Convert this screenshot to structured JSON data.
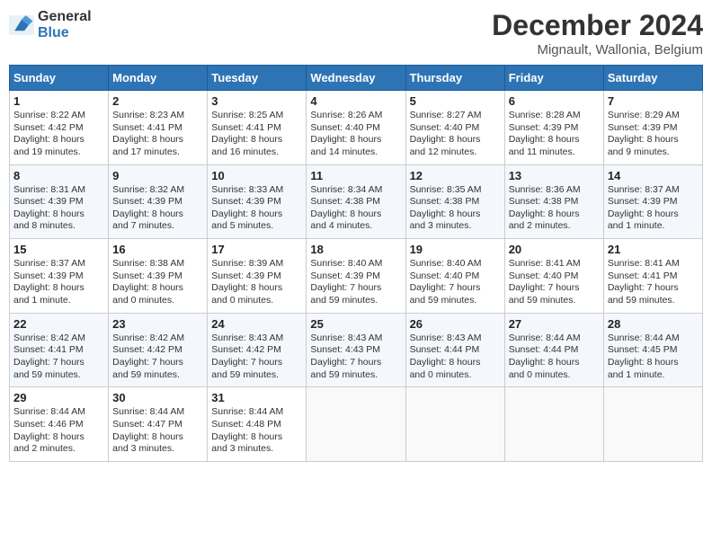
{
  "logo": {
    "general": "General",
    "blue": "Blue"
  },
  "title": "December 2024",
  "subtitle": "Mignault, Wallonia, Belgium",
  "days_header": [
    "Sunday",
    "Monday",
    "Tuesday",
    "Wednesday",
    "Thursday",
    "Friday",
    "Saturday"
  ],
  "weeks": [
    [
      {
        "day": "1",
        "lines": [
          "Sunrise: 8:22 AM",
          "Sunset: 4:42 PM",
          "Daylight: 8 hours",
          "and 19 minutes."
        ]
      },
      {
        "day": "2",
        "lines": [
          "Sunrise: 8:23 AM",
          "Sunset: 4:41 PM",
          "Daylight: 8 hours",
          "and 17 minutes."
        ]
      },
      {
        "day": "3",
        "lines": [
          "Sunrise: 8:25 AM",
          "Sunset: 4:41 PM",
          "Daylight: 8 hours",
          "and 16 minutes."
        ]
      },
      {
        "day": "4",
        "lines": [
          "Sunrise: 8:26 AM",
          "Sunset: 4:40 PM",
          "Daylight: 8 hours",
          "and 14 minutes."
        ]
      },
      {
        "day": "5",
        "lines": [
          "Sunrise: 8:27 AM",
          "Sunset: 4:40 PM",
          "Daylight: 8 hours",
          "and 12 minutes."
        ]
      },
      {
        "day": "6",
        "lines": [
          "Sunrise: 8:28 AM",
          "Sunset: 4:39 PM",
          "Daylight: 8 hours",
          "and 11 minutes."
        ]
      },
      {
        "day": "7",
        "lines": [
          "Sunrise: 8:29 AM",
          "Sunset: 4:39 PM",
          "Daylight: 8 hours",
          "and 9 minutes."
        ]
      }
    ],
    [
      {
        "day": "8",
        "lines": [
          "Sunrise: 8:31 AM",
          "Sunset: 4:39 PM",
          "Daylight: 8 hours",
          "and 8 minutes."
        ]
      },
      {
        "day": "9",
        "lines": [
          "Sunrise: 8:32 AM",
          "Sunset: 4:39 PM",
          "Daylight: 8 hours",
          "and 7 minutes."
        ]
      },
      {
        "day": "10",
        "lines": [
          "Sunrise: 8:33 AM",
          "Sunset: 4:39 PM",
          "Daylight: 8 hours",
          "and 5 minutes."
        ]
      },
      {
        "day": "11",
        "lines": [
          "Sunrise: 8:34 AM",
          "Sunset: 4:38 PM",
          "Daylight: 8 hours",
          "and 4 minutes."
        ]
      },
      {
        "day": "12",
        "lines": [
          "Sunrise: 8:35 AM",
          "Sunset: 4:38 PM",
          "Daylight: 8 hours",
          "and 3 minutes."
        ]
      },
      {
        "day": "13",
        "lines": [
          "Sunrise: 8:36 AM",
          "Sunset: 4:38 PM",
          "Daylight: 8 hours",
          "and 2 minutes."
        ]
      },
      {
        "day": "14",
        "lines": [
          "Sunrise: 8:37 AM",
          "Sunset: 4:39 PM",
          "Daylight: 8 hours",
          "and 1 minute."
        ]
      }
    ],
    [
      {
        "day": "15",
        "lines": [
          "Sunrise: 8:37 AM",
          "Sunset: 4:39 PM",
          "Daylight: 8 hours",
          "and 1 minute."
        ]
      },
      {
        "day": "16",
        "lines": [
          "Sunrise: 8:38 AM",
          "Sunset: 4:39 PM",
          "Daylight: 8 hours",
          "and 0 minutes."
        ]
      },
      {
        "day": "17",
        "lines": [
          "Sunrise: 8:39 AM",
          "Sunset: 4:39 PM",
          "Daylight: 8 hours",
          "and 0 minutes."
        ]
      },
      {
        "day": "18",
        "lines": [
          "Sunrise: 8:40 AM",
          "Sunset: 4:39 PM",
          "Daylight: 7 hours",
          "and 59 minutes."
        ]
      },
      {
        "day": "19",
        "lines": [
          "Sunrise: 8:40 AM",
          "Sunset: 4:40 PM",
          "Daylight: 7 hours",
          "and 59 minutes."
        ]
      },
      {
        "day": "20",
        "lines": [
          "Sunrise: 8:41 AM",
          "Sunset: 4:40 PM",
          "Daylight: 7 hours",
          "and 59 minutes."
        ]
      },
      {
        "day": "21",
        "lines": [
          "Sunrise: 8:41 AM",
          "Sunset: 4:41 PM",
          "Daylight: 7 hours",
          "and 59 minutes."
        ]
      }
    ],
    [
      {
        "day": "22",
        "lines": [
          "Sunrise: 8:42 AM",
          "Sunset: 4:41 PM",
          "Daylight: 7 hours",
          "and 59 minutes."
        ]
      },
      {
        "day": "23",
        "lines": [
          "Sunrise: 8:42 AM",
          "Sunset: 4:42 PM",
          "Daylight: 7 hours",
          "and 59 minutes."
        ]
      },
      {
        "day": "24",
        "lines": [
          "Sunrise: 8:43 AM",
          "Sunset: 4:42 PM",
          "Daylight: 7 hours",
          "and 59 minutes."
        ]
      },
      {
        "day": "25",
        "lines": [
          "Sunrise: 8:43 AM",
          "Sunset: 4:43 PM",
          "Daylight: 7 hours",
          "and 59 minutes."
        ]
      },
      {
        "day": "26",
        "lines": [
          "Sunrise: 8:43 AM",
          "Sunset: 4:44 PM",
          "Daylight: 8 hours",
          "and 0 minutes."
        ]
      },
      {
        "day": "27",
        "lines": [
          "Sunrise: 8:44 AM",
          "Sunset: 4:44 PM",
          "Daylight: 8 hours",
          "and 0 minutes."
        ]
      },
      {
        "day": "28",
        "lines": [
          "Sunrise: 8:44 AM",
          "Sunset: 4:45 PM",
          "Daylight: 8 hours",
          "and 1 minute."
        ]
      }
    ],
    [
      {
        "day": "29",
        "lines": [
          "Sunrise: 8:44 AM",
          "Sunset: 4:46 PM",
          "Daylight: 8 hours",
          "and 2 minutes."
        ]
      },
      {
        "day": "30",
        "lines": [
          "Sunrise: 8:44 AM",
          "Sunset: 4:47 PM",
          "Daylight: 8 hours",
          "and 3 minutes."
        ]
      },
      {
        "day": "31",
        "lines": [
          "Sunrise: 8:44 AM",
          "Sunset: 4:48 PM",
          "Daylight: 8 hours",
          "and 3 minutes."
        ]
      },
      null,
      null,
      null,
      null
    ]
  ]
}
